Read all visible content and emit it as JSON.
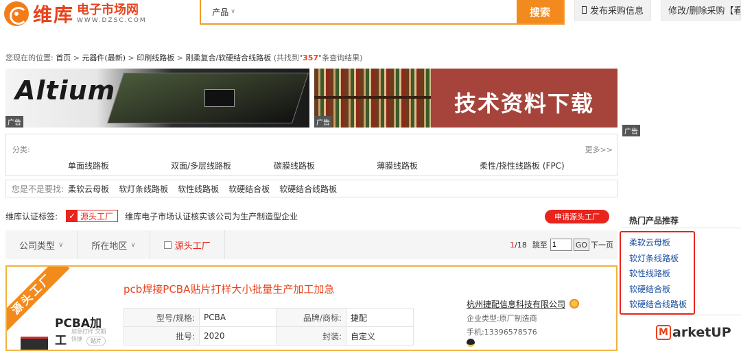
{
  "header": {
    "logo_main": "维库",
    "logo_sub_cn": "电子市场网",
    "logo_sub_en": "WWW.DZSC.COM",
    "search_category": "产品",
    "search_placeholder": "",
    "search_button": "搜索",
    "publish_button": "发布采购信息",
    "modify_button": "修改/删除采购【看"
  },
  "breadcrumb": {
    "prefix": "您现在的位置:",
    "items": [
      "首页",
      "元器件(最新)",
      "印刷线路板",
      "刚柔复合/软硬结合线路板"
    ],
    "sep": ">",
    "result_prefix": "(共找到\"",
    "result_count": "357",
    "result_suffix": "\"条查询结果)"
  },
  "banners": {
    "altium_text": "Altium",
    "tech_text": "技术资料下载",
    "ad_label": "广告"
  },
  "categories": {
    "label": "分类:",
    "more": "更多>>",
    "items": [
      "单面线路板",
      "双面/多层线路板",
      "碳膜线路板",
      "薄膜线路板",
      "柔性/挠性线路板 (FPC)"
    ]
  },
  "suggest": {
    "label": "您是不是要找:",
    "items": [
      "柔软云母板",
      "软灯条线路板",
      "软性线路板",
      "软硬结合板",
      "软硬结合线路板"
    ]
  },
  "cert": {
    "label": "维库认证标签:",
    "badge": "源头工厂",
    "desc": "维库电子市场认证核实该公司为生产制造型企业",
    "apply": "申请源头工厂"
  },
  "filters": {
    "company_type": "公司类型",
    "region": "所在地区",
    "source_factory": "源头工厂"
  },
  "pager": {
    "current": "1",
    "total": "/18",
    "jump_label": "跳至",
    "jump_value": "1",
    "go": "GO",
    "next": "下一页"
  },
  "product": {
    "ribbon": "源头工厂",
    "img_title": "PCBA加工",
    "img_sub": "加急打样 交期快捷",
    "img_tag": "贴片",
    "title": "pcb焊接PCBA贴片打样大小批量生产加工加急",
    "specs": [
      {
        "k1": "型号/规格:",
        "v1": "PCBA",
        "k2": "品牌/商标:",
        "v2": "捷配"
      },
      {
        "k1": "批号:",
        "v1": "2020",
        "k2": "封装:",
        "v2": "自定义"
      }
    ],
    "company_name": "杭州捷配信息科技有限公司",
    "company_type": "企业类型:原厂制造商",
    "phone": "手机:13396578576"
  },
  "sidebar": {
    "hot_title": "热门产品推荐",
    "hot_items": [
      "柔软云母板",
      "软灯条线路板",
      "软性线路板",
      "软硬结合板",
      "软硬结合线路板"
    ],
    "brand": "arketUP"
  },
  "colors": {
    "accent": "#f28a1d",
    "red": "#e8241c",
    "link": "#1a4fa3"
  }
}
